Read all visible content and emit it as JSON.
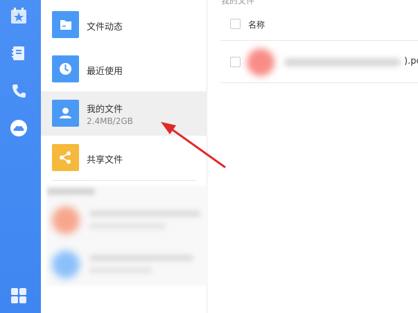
{
  "nav": {
    "items": [
      {
        "label": "文件动态",
        "icon": "folder-icon",
        "color": "#4a9af5"
      },
      {
        "label": "最近使用",
        "icon": "clock-icon",
        "color": "#4a9af5"
      },
      {
        "label": "我的文件",
        "sub": "2.4MB/2GB",
        "icon": "user-icon",
        "color": "#4a9af5",
        "active": true
      },
      {
        "label": "共享文件",
        "icon": "share-icon",
        "color": "#f5b93c"
      }
    ]
  },
  "main": {
    "breadcrumb": "我的文件",
    "column_name": "名称",
    "file_tail": ").pc"
  },
  "colors": {
    "rail": "#4a90f5",
    "accent_arrow": "#e02a2a"
  }
}
